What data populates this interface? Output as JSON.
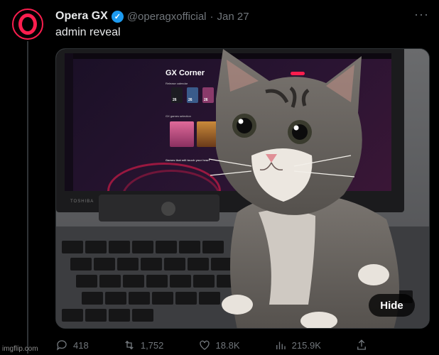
{
  "tweet": {
    "author_name": "Opera GX",
    "handle": "@operagxofficial",
    "separator": "·",
    "date": "Jan 27",
    "text": "admin reveal",
    "more_label": "···"
  },
  "media": {
    "hide_label": "Hide",
    "screen_title": "GX Corner",
    "screen_section_1": "Release calendar",
    "screen_section_2": "GX games selection",
    "screen_section_3": "Games that will touch your heart",
    "laptop_brand": "TOSHIBA",
    "game_dates": [
      "26",
      "26",
      "26"
    ]
  },
  "actions": {
    "replies": "418",
    "retweets": "1,752",
    "likes": "18.8K",
    "views": "215.9K"
  },
  "colors": {
    "brand_red": "#fa1e4e",
    "verified_blue": "#1d9bf0",
    "muted": "#71767b"
  },
  "watermark": "imgflip.com"
}
